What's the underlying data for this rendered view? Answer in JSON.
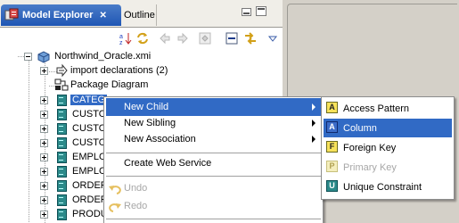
{
  "tabs": {
    "model_explorer": "Model Explorer",
    "outline": "Outline",
    "close_glyph": "✕"
  },
  "tree": {
    "root": "Northwind_Oracle.xmi",
    "import_declarations": "import declarations (2)",
    "package_diagram": "Package Diagram",
    "tables": [
      "CATEG",
      "CUSTO",
      "CUSTO",
      "CUSTO",
      "EMPLO",
      "EMPLO",
      "ORDER",
      "ORDER",
      "PRODU"
    ]
  },
  "context_menu": {
    "new_child": "New Child",
    "new_sibling": "New Sibling",
    "new_association": "New Association",
    "create_web_service": "Create Web Service",
    "undo": "Undo",
    "redo": "Redo"
  },
  "submenu": {
    "access_pattern": "Access Pattern",
    "column": "Column",
    "foreign_key": "Foreign Key",
    "primary_key": "Primary Key",
    "unique_constraint": "Unique Constraint",
    "icon_letters": {
      "access_pattern": "A",
      "column": "A",
      "foreign_key": "F",
      "primary_key": "P",
      "unique_constraint": "U"
    }
  },
  "colors": {
    "selection": "#316ac5",
    "active_tab": "#1f56b4",
    "table_icon": "#2c8a8a"
  },
  "icons": {
    "tab": "model-explorer-icon",
    "toolbar": [
      "sort-alpha-icon",
      "sync-icon",
      "back-icon",
      "forward-icon",
      "home-icon",
      "collapse-all-icon",
      "link-with-editor-icon",
      "view-menu-icon"
    ],
    "undo": "undo-icon",
    "redo": "redo-icon"
  }
}
